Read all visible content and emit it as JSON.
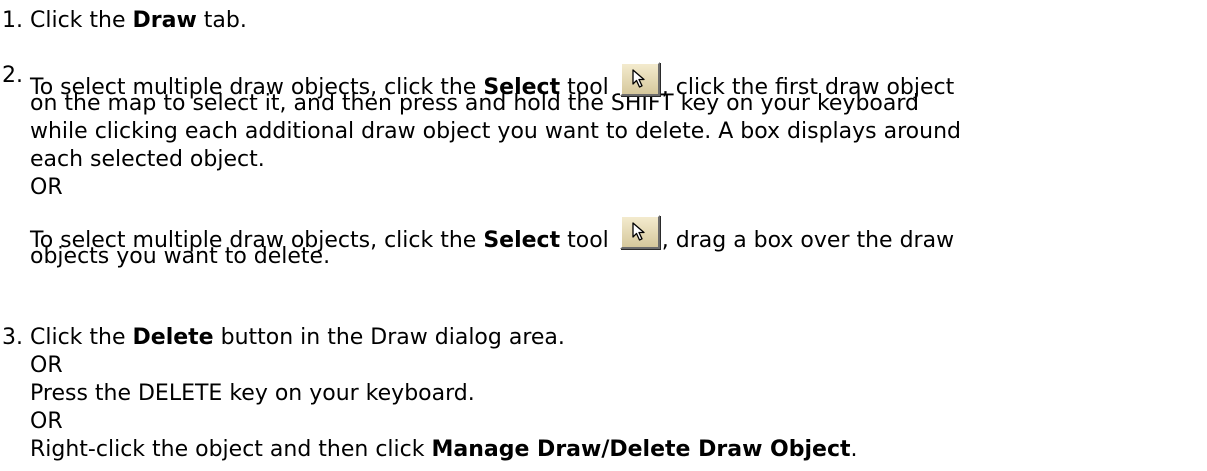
{
  "steps": [
    {
      "number": "1.",
      "lines": [
        [
          {
            "text": "Click the "
          },
          {
            "text": "Draw",
            "bold": true
          },
          {
            "text": " tab."
          }
        ]
      ]
    },
    {
      "number": "2.",
      "lines": [
        [
          {
            "text": "To select multiple draw objects, click the "
          },
          {
            "text": "Select",
            "bold": true
          },
          {
            "text": " tool "
          },
          {
            "icon": "select-arrow-icon"
          },
          {
            "text": ", click the first draw object"
          }
        ],
        [
          {
            "text": "on the map to select it, and then press and hold the SHIFT key on your keyboard"
          }
        ],
        [
          {
            "text": "while clicking each additional draw object you want to delete. A box displays around"
          }
        ],
        [
          {
            "text": "each selected object."
          }
        ],
        [
          {
            "text": "OR"
          }
        ]
      ]
    },
    {
      "number": "",
      "lines": [
        [
          {
            "text": "To select multiple draw objects, click the "
          },
          {
            "text": "Select",
            "bold": true
          },
          {
            "text": " tool "
          },
          {
            "icon": "select-arrow-icon"
          },
          {
            "text": ", drag a box over the draw"
          }
        ],
        [
          {
            "text": "objects you want to delete."
          }
        ]
      ]
    },
    {
      "number": "3.",
      "lines": [
        [
          {
            "text": "Click the "
          },
          {
            "text": "Delete",
            "bold": true
          },
          {
            "text": " button in the Draw dialog area."
          }
        ],
        [
          {
            "text": "OR"
          }
        ],
        [
          {
            "text": "Press the DELETE key on your keyboard."
          }
        ],
        [
          {
            "text": "OR"
          }
        ],
        [
          {
            "text": "Right-click the object and then click "
          },
          {
            "text": "Manage Draw/Delete Draw Object",
            "bold": true
          },
          {
            "text": "."
          }
        ]
      ]
    }
  ],
  "colors": {
    "text": "#000000",
    "background": "#ffffff",
    "button_face": "#e8dcb5"
  }
}
